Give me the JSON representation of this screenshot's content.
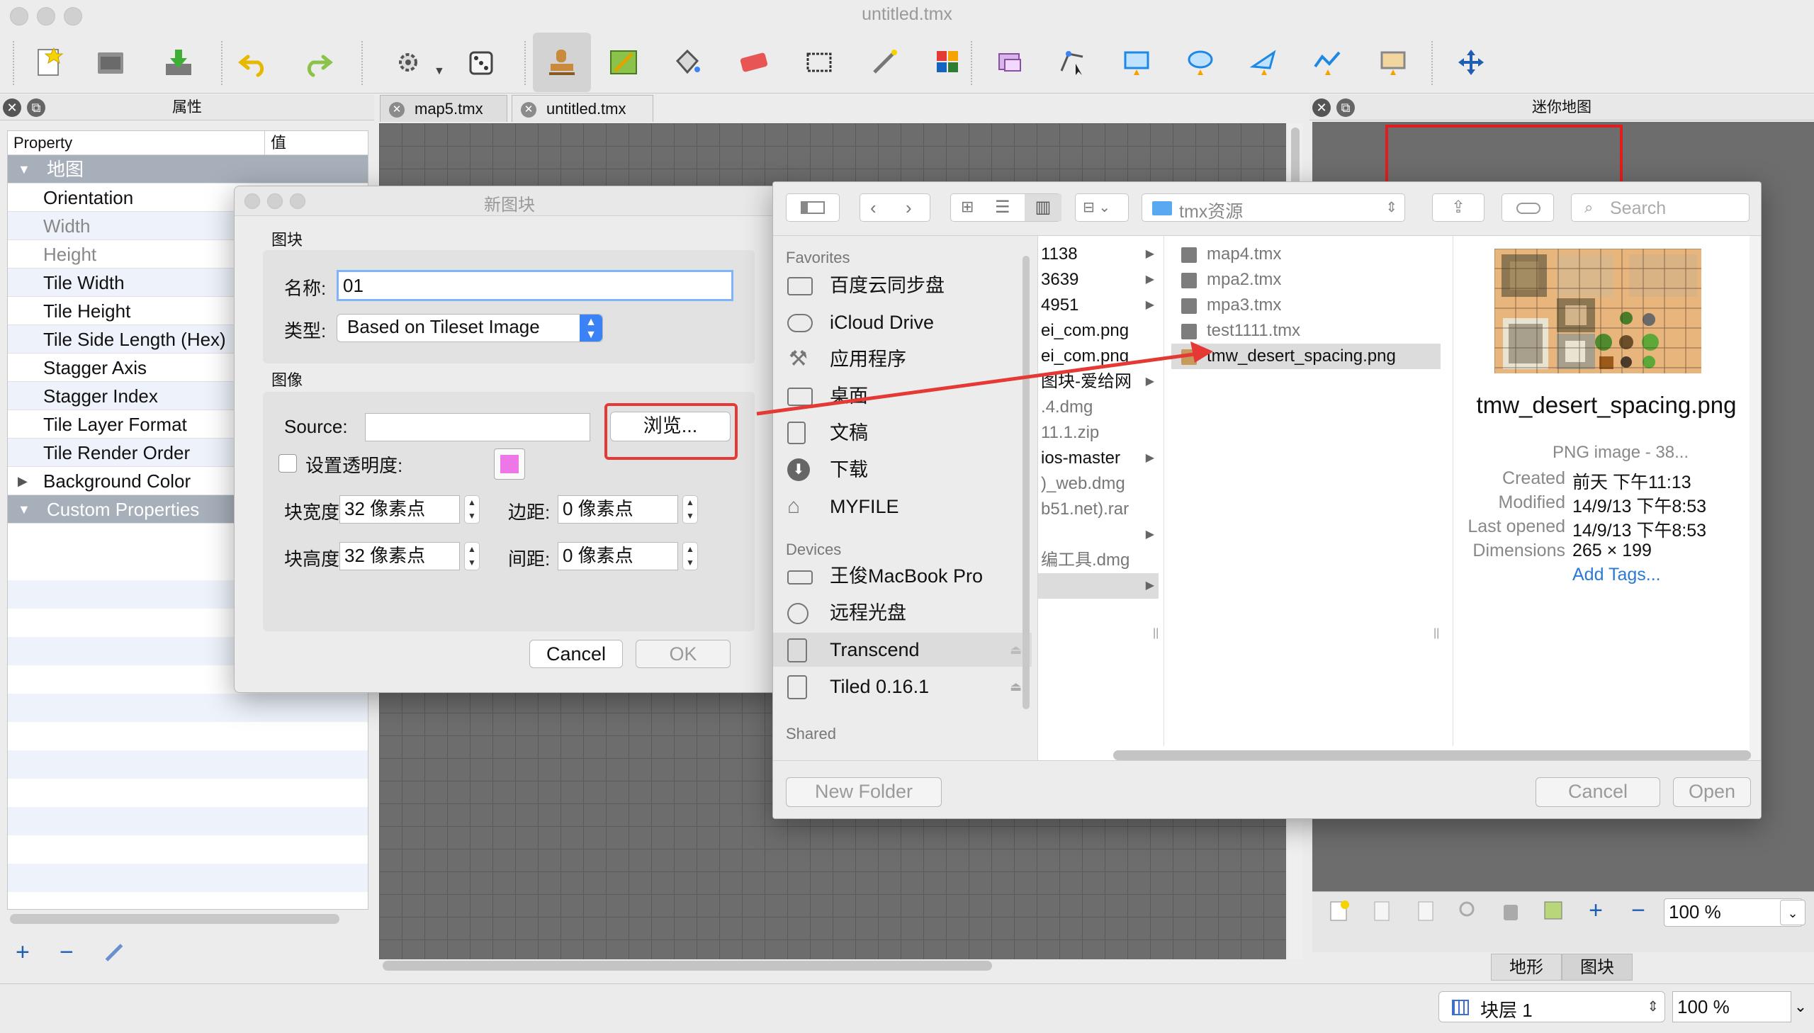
{
  "window": {
    "title": "untitled.tmx"
  },
  "tabs": [
    {
      "label": "map5.tmx"
    },
    {
      "label": "untitled.tmx"
    }
  ],
  "properties_panel": {
    "title": "属性",
    "col_property": "Property",
    "col_value": "值",
    "group_map": "地图",
    "rows": [
      "Orientation",
      "Width",
      "Height",
      "Tile Width",
      "Tile Height",
      "Tile Side Length (Hex)",
      "Stagger Axis",
      "Stagger Index",
      "Tile Layer Format",
      "Tile Render Order",
      "Background Color"
    ],
    "group_custom": "Custom Properties"
  },
  "minimap_panel": {
    "title": "迷你地图"
  },
  "tileset_dialog": {
    "title": "新图块",
    "section_tileset": "图块",
    "name_label": "名称:",
    "name_value": "01",
    "type_label": "类型:",
    "type_value": "Based on Tileset Image",
    "section_image": "图像",
    "source_label": "Source:",
    "source_value": "",
    "browse_label": "浏览...",
    "transparency_label": "设置透明度:",
    "transparency_color": "#ee77e8",
    "tile_width_label": "块宽度:",
    "tile_width_value": "32 像素点",
    "margin_label": "边距:",
    "margin_value": "0 像素点",
    "tile_height_label": "块高度:",
    "tile_height_value": "32 像素点",
    "spacing_label": "间距:",
    "spacing_value": "0 像素点",
    "cancel_label": "Cancel",
    "ok_label": "OK"
  },
  "file_dialog": {
    "folder": "tmx资源",
    "search_placeholder": "Search",
    "sidebar": {
      "favorites_header": "Favorites",
      "favorites": [
        "百度云同步盘",
        "iCloud Drive",
        "应用程序",
        "桌面",
        "文稿",
        "下载",
        "MYFILE"
      ],
      "devices_header": "Devices",
      "devices": [
        "王俊MacBook Pro",
        "远程光盘",
        "Transcend",
        "Tiled 0.16.1"
      ],
      "shared_header": "Shared"
    },
    "column1": [
      "1138",
      "3639",
      "4951",
      "ei_com.png",
      "ei_com.png",
      "图块-爱给网",
      ".4.dmg",
      "11.1.zip",
      "ios-master",
      ")_web.dmg",
      "b51.net).rar",
      "",
      "编工具.dmg",
      ""
    ],
    "column2": [
      "map4.tmx",
      "mpa2.tmx",
      "mpa3.tmx",
      "test1111.tmx",
      "tmw_desert_spacing.png"
    ],
    "preview": {
      "filename": "tmw_desert_spacing.png",
      "kind": "PNG image - 38...",
      "created_label": "Created",
      "created_value": "前天 下午11:13",
      "modified_label": "Modified",
      "modified_value": "14/9/13 下午8:53",
      "opened_label": "Last opened",
      "opened_value": "14/9/13 下午8:53",
      "dims_label": "Dimensions",
      "dims_value": "265 × 199",
      "add_tags": "Add Tags..."
    },
    "new_folder_label": "New Folder",
    "cancel_label": "Cancel",
    "open_label": "Open"
  },
  "tileset_panel": {
    "zoom_value": "100 %",
    "tab_terrain": "地形",
    "tab_tileset": "图块"
  },
  "statusbar": {
    "layer_value": "块层 1",
    "zoom_value": "100 %"
  },
  "colors": {
    "annotation_red": "#e53935",
    "accent_blue": "#3b82f6",
    "selection_grey": "#a7afba"
  }
}
